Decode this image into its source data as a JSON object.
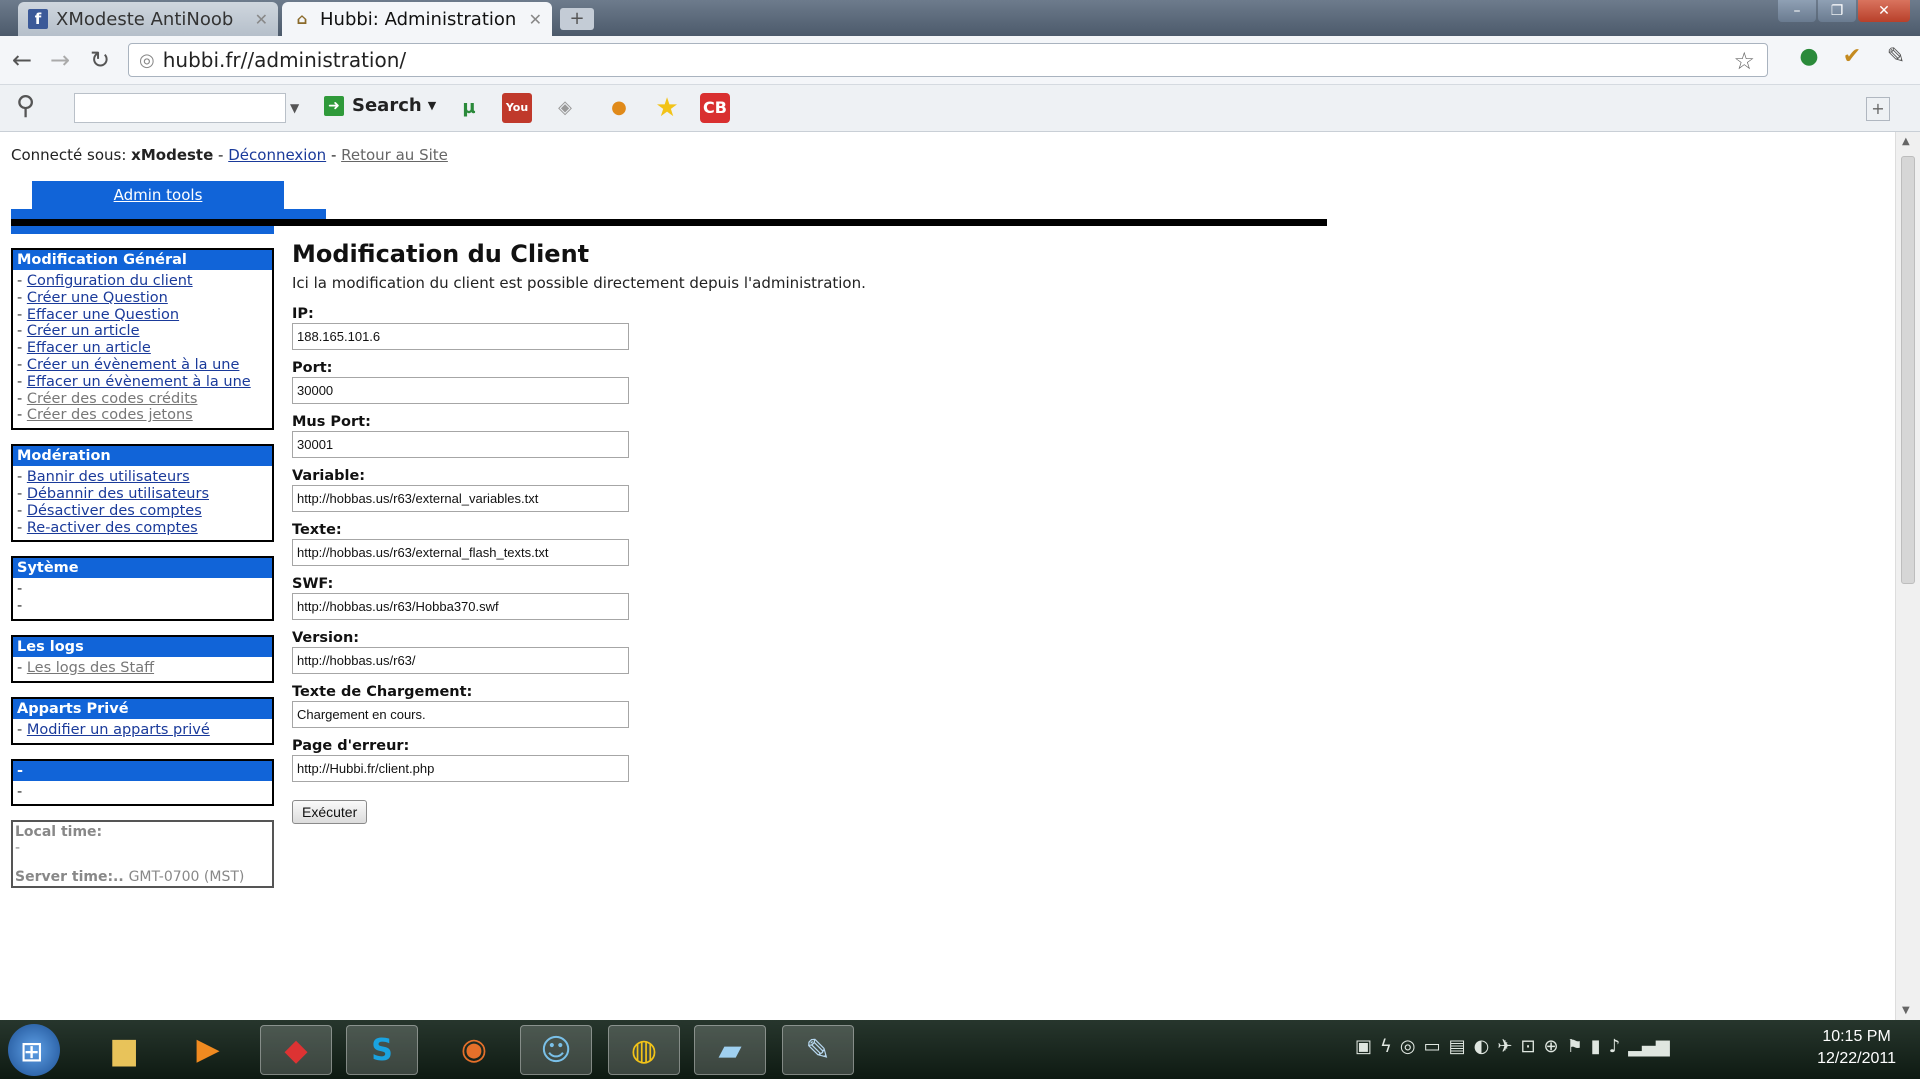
{
  "browser": {
    "tabs": [
      {
        "label": "XModeste AntiNoob",
        "icon": "facebook-icon"
      },
      {
        "label": "Hubbi: Administration",
        "icon": "hubbi-icon"
      }
    ],
    "address": "hubbi.fr//administration/",
    "toolbar": {
      "search_label": "Search"
    }
  },
  "header": {
    "connected_label": "Connecté sous:",
    "username": "xModeste",
    "logout": "Déconnexion",
    "back_to_site": "Retour au Site",
    "admin_tab": "Admin tools"
  },
  "sidebar": {
    "general": {
      "title": "Modification Général",
      "items": [
        "Configuration du client",
        "Créer une Question",
        "Effacer une Question",
        "Créer un article",
        "Effacer un article",
        "Créer un évènement à la une",
        "Effacer un évènement à la une",
        "Créer des codes crédits",
        "Créer des codes jetons"
      ]
    },
    "moderation": {
      "title": "Modération",
      "items": [
        "Bannir des utilisateurs",
        "Débannir des utilisateurs",
        "Désactiver des comptes",
        "Re-activer des comptes"
      ]
    },
    "system": {
      "title": "Sytème"
    },
    "logs": {
      "title": "Les logs",
      "items": [
        "Les logs des Staff"
      ]
    },
    "private": {
      "title": "Apparts Privé",
      "items": [
        "Modifier un apparts privé"
      ]
    },
    "empty_title": "-",
    "dash": "-",
    "time": {
      "local_label": "Local time:",
      "local_value": "-",
      "server_label": "Server time:..",
      "server_value": "GMT-0700 (MST)"
    }
  },
  "main": {
    "title": "Modification du Client",
    "description": "Ici la modification du client est possible directement depuis l'administration.",
    "fields": [
      {
        "label": "IP:",
        "value": "188.165.101.6"
      },
      {
        "label": "Port:",
        "value": "30000"
      },
      {
        "label": "Mus Port:",
        "value": "30001"
      },
      {
        "label": "Variable:",
        "value": "http://hobbas.us/r63/external_variables.txt"
      },
      {
        "label": "Texte:",
        "value": "http://hobbas.us/r63/external_flash_texts.txt"
      },
      {
        "label": "SWF:",
        "value": "http://hobbas.us/r63/Hobba370.swf"
      },
      {
        "label": "Version:",
        "value": "http://hobbas.us/r63/"
      },
      {
        "label": "Texte de Chargement:",
        "value": "Chargement en cours."
      },
      {
        "label": "Page d'erreur:",
        "value": "http://Hubbi.fr/client.php"
      }
    ],
    "submit_label": "Exécuter"
  },
  "taskbar": {
    "time": "10:15 PM",
    "date": "12/22/2011"
  }
}
